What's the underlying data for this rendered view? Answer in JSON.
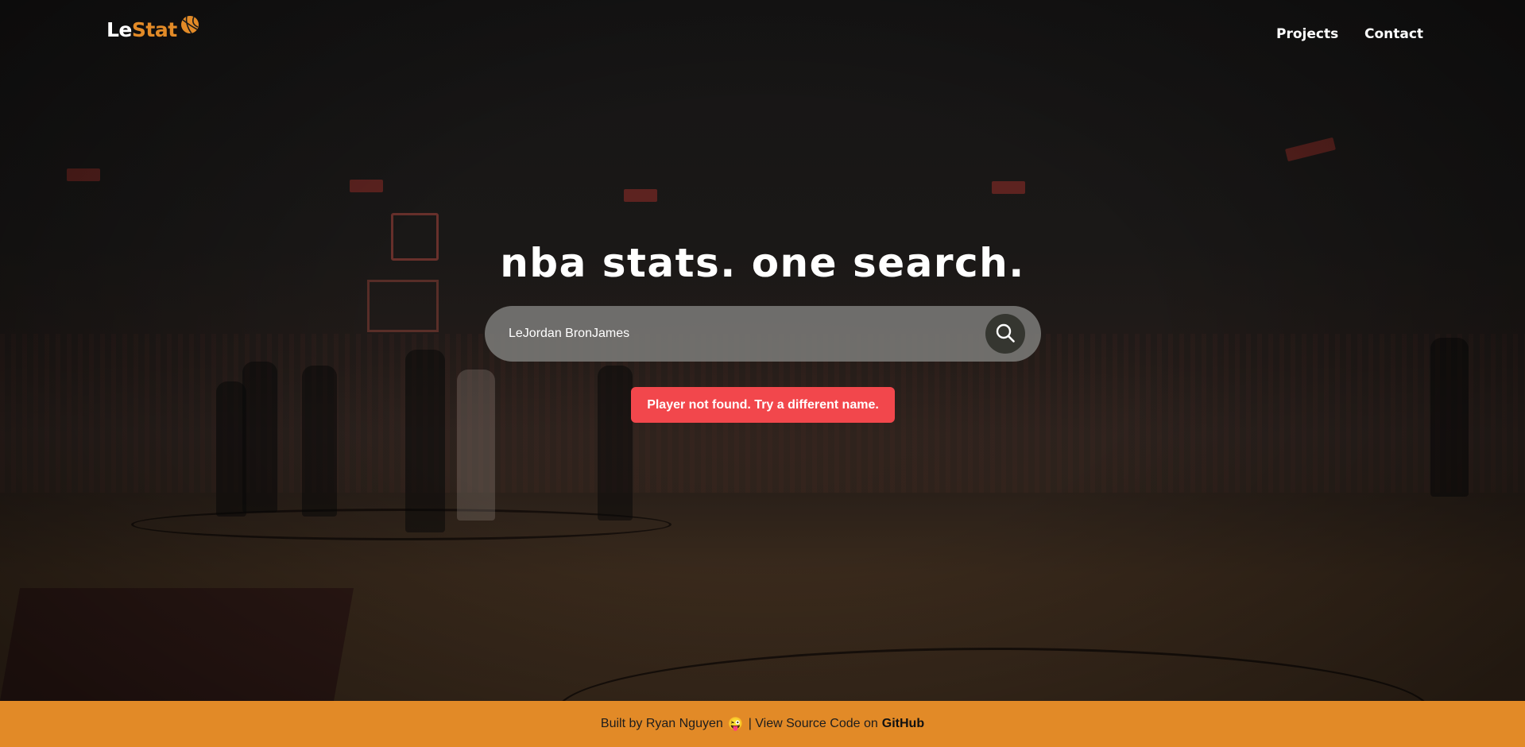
{
  "nav": {
    "logo_part1": "Le",
    "logo_part2": "Stat",
    "logo_icon": "basketball-icon",
    "links": [
      "Projects",
      "Contact"
    ]
  },
  "hero": {
    "headline": "nba stats. one search."
  },
  "search": {
    "value": "LeJordan BronJames",
    "button_icon": "search-icon"
  },
  "error": {
    "message": "Player not found. Try a different name."
  },
  "footer": {
    "built_by": "Built by Ryan Nguyen",
    "emoji": "😜",
    "separator_text": "| View Source Code on",
    "github_link": "GitHub"
  },
  "colors": {
    "accent": "#e28a27",
    "error": "#f2474c",
    "search_bg": "#80807e",
    "search_button": "#353630"
  }
}
